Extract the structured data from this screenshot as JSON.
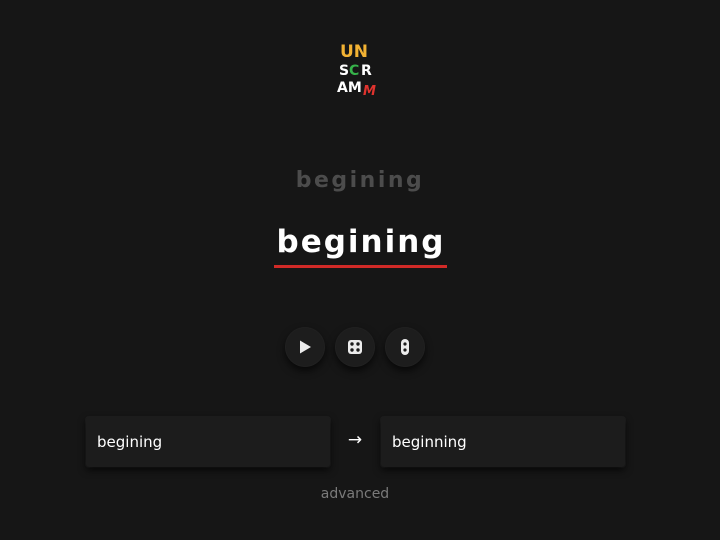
{
  "logo": {
    "line1": "UN",
    "line2_a": "S",
    "line2_b": "C",
    "line2_c": "R",
    "line3_a": "AM",
    "line3_b": "M",
    "colors": {
      "yellow": "#f2b233",
      "green": "#36b24a",
      "red": "#e0332e",
      "white": "#ffffff"
    }
  },
  "ghost_word": "begining",
  "main_word": "begining",
  "accent_color": "#d12a27",
  "controls": {
    "play_icon": "play-icon",
    "dice_icon": "dice-icon",
    "toggle_icon": "traffic-light-icon"
  },
  "inputs": {
    "source_value": "begining",
    "target_value": "beginning"
  },
  "arrow": "→",
  "advanced_label": "advanced"
}
